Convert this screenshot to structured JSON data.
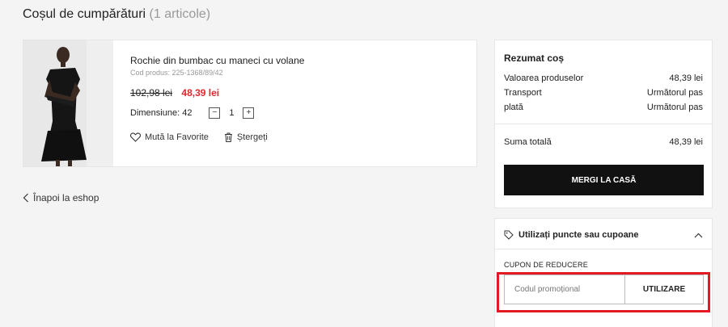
{
  "page": {
    "title": "Coșul de cumpărături",
    "count": "(1 articole)"
  },
  "product": {
    "name": "Rochie din bumbac cu maneci cu volane",
    "code": "Cod produs: 225-1368/89/42",
    "price_old": "102,98 lei",
    "price_new": "48,39 lei",
    "size_label": "Dimensiune: 42",
    "quantity": "1",
    "qty_minus": "−",
    "qty_plus": "+",
    "favorite_label": "Mută la Favorite",
    "delete_label": "Ștergeți",
    "image_icon": "dress-model-photo"
  },
  "back_link": "Înapoi la eshop",
  "summary": {
    "title": "Rezumat coș",
    "rows": [
      {
        "label": "Valoarea produselor",
        "value": "48,39 lei"
      },
      {
        "label": "Transport",
        "value": "Următorul pas"
      },
      {
        "label": "plată",
        "value": "Următorul pas"
      }
    ],
    "total_label": "Suma totală",
    "total_value": "48,39 lei",
    "checkout_label": "MERGI LA CASĂ"
  },
  "coupon": {
    "header": "Utilizați puncte sau cupoane",
    "label": "CUPON DE REDUCERE",
    "placeholder": "Codul promoțional",
    "apply_label": "UTILIZARE"
  },
  "colors": {
    "sale_price": "#e1262d",
    "checkout_bg": "#111111",
    "highlight": "#e21b23",
    "page_bg": "#f4f4f4"
  }
}
